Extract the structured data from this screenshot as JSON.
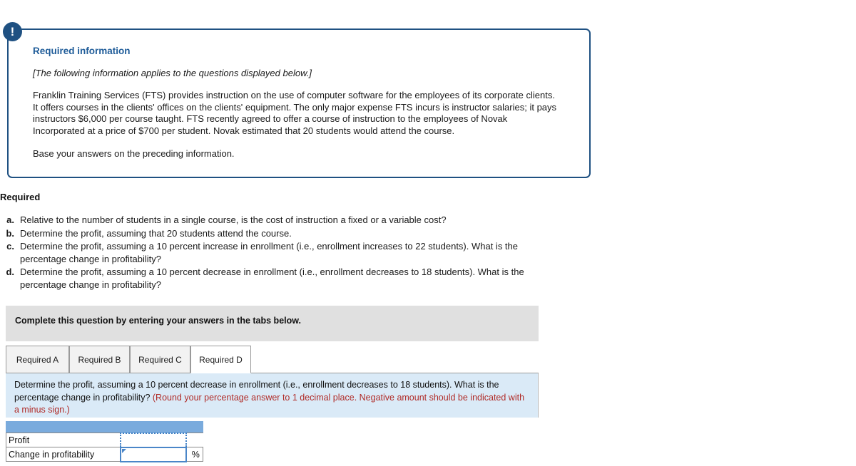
{
  "callout": {
    "icon": "exclamation-icon",
    "title": "Required information",
    "applies_note": "[The following information applies to the questions displayed below.]",
    "scenario": "Franklin Training Services (FTS) provides instruction on the use of computer software for the employees of its corporate clients. It offers courses in the clients' offices on the clients' equipment. The only major expense FTS incurs is instructor salaries; it pays instructors $6,000 per course taught. FTS recently agreed to offer a course of instruction to the employees of Novak Incorporated at a price of $700 per student. Novak estimated that 20 students would attend the course.",
    "base_note": "Base your answers on the preceding information."
  },
  "required": {
    "heading": "Required",
    "items": [
      {
        "letter": "a.",
        "text": "Relative to the number of students in a single course, is the cost of instruction a fixed or a variable cost?"
      },
      {
        "letter": "b.",
        "text": "Determine the profit, assuming that 20 students attend the course."
      },
      {
        "letter": "c.",
        "text": "Determine the profit, assuming a 10 percent increase in enrollment (i.e., enrollment increases to 22 students). What is the percentage change in profitability?"
      },
      {
        "letter": "d.",
        "text": "Determine the profit, assuming a 10 percent decrease in enrollment (i.e., enrollment decreases to 18 students). What is the percentage change in profitability?"
      }
    ]
  },
  "complete_bar": {
    "label": "Complete this question by entering your answers in the tabs below."
  },
  "tabs": [
    {
      "label": "Required A",
      "active": false
    },
    {
      "label": "Required B",
      "active": false
    },
    {
      "label": "Required C",
      "active": false
    },
    {
      "label": "Required D",
      "active": true
    }
  ],
  "question_panel": {
    "prompt": "Determine the profit, assuming a 10 percent decrease in enrollment (i.e., enrollment decreases to 18 students). What is the percentage change in profitability? ",
    "hint": "(Round your percentage answer to 1 decimal place. Negative amount should be indicated with a minus sign.)"
  },
  "answer_table": {
    "header_blank": "",
    "rows": [
      {
        "label": "Profit",
        "value": "",
        "unit": ""
      },
      {
        "label": "Change in profitability",
        "value": "",
        "unit": "%"
      }
    ]
  },
  "colors": {
    "callout_border": "#1f5182",
    "callout_title": "#1f5c99",
    "gray_bar": "#e0e0e0",
    "panel_blue": "#daeaf7",
    "hint_red": "#b02b27",
    "table_header_blue": "#7aabdd",
    "focus_blue": "#4a86c8"
  }
}
